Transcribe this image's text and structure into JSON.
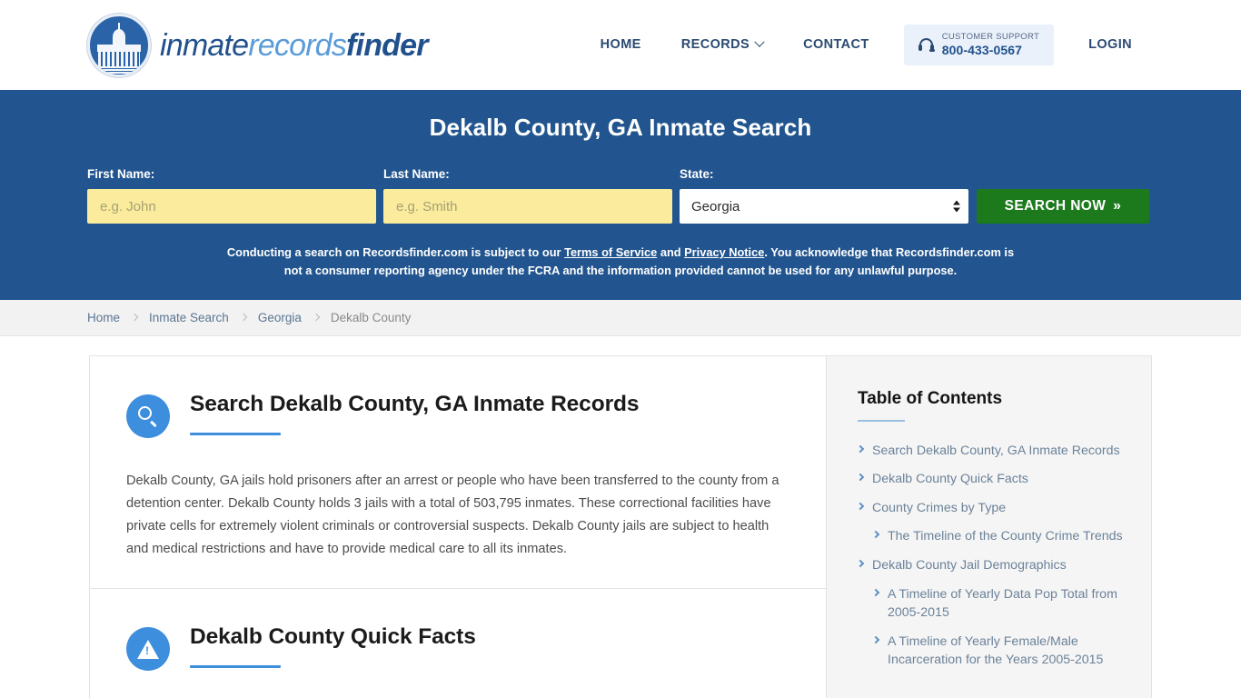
{
  "header": {
    "logo": {
      "part1": "inmate",
      "part2": "records",
      "part3": "finder",
      "icon": "capitol-seal-icon"
    },
    "nav": [
      {
        "label": "HOME",
        "has_caret": false
      },
      {
        "label": "RECORDS",
        "has_caret": true
      },
      {
        "label": "CONTACT",
        "has_caret": false
      }
    ],
    "support": {
      "label": "CUSTOMER SUPPORT",
      "phone": "800-433-0567",
      "icon": "headset-icon"
    },
    "login": "LOGIN"
  },
  "hero": {
    "title": "Dekalb County, GA Inmate Search",
    "fields": {
      "first_name_label": "First Name:",
      "first_name_placeholder": "e.g. John",
      "first_name_value": "",
      "last_name_label": "Last Name:",
      "last_name_placeholder": "e.g. Smith",
      "last_name_value": "",
      "state_label": "State:",
      "state_value": "Georgia"
    },
    "search_button": "SEARCH NOW",
    "search_button_chevrons": "»",
    "disclaimer": {
      "part1": "Conducting a search on Recordsfinder.com is subject to our ",
      "link1": "Terms of Service",
      "part2": " and ",
      "link2": "Privacy Notice",
      "part3": ". You acknowledge that Recordsfinder.com is not a consumer reporting agency under the FCRA and the information provided cannot be used for any unlawful purpose."
    }
  },
  "breadcrumb": [
    {
      "label": "Home",
      "current": false
    },
    {
      "label": "Inmate Search",
      "current": false
    },
    {
      "label": "Georgia",
      "current": false
    },
    {
      "label": "Dekalb County",
      "current": true
    }
  ],
  "main": {
    "sections": [
      {
        "icon": "search-circle-icon",
        "title": "Search Dekalb County, GA Inmate Records",
        "body": "Dekalb County, GA jails hold prisoners after an arrest or people who have been transferred to the county from a detention center. Dekalb County holds 3 jails with a total of 503,795 inmates. These correctional facilities have private cells for extremely violent criminals or controversial suspects. Dekalb County jails are subject to health and medical restrictions and have to provide medical care to all its inmates."
      },
      {
        "icon": "warning-circle-icon",
        "title": "Dekalb County Quick Facts",
        "body": ""
      }
    ]
  },
  "toc": {
    "title": "Table of Contents",
    "items": [
      {
        "label": "Search Dekalb County, GA Inmate Records",
        "level": 1
      },
      {
        "label": "Dekalb County Quick Facts",
        "level": 1
      },
      {
        "label": "County Crimes by Type",
        "level": 1
      },
      {
        "label": "The Timeline of the County Crime Trends",
        "level": 2
      },
      {
        "label": "Dekalb County Jail Demographics",
        "level": 1
      },
      {
        "label": "A Timeline of Yearly Data Pop Total from 2005-2015",
        "level": 2
      },
      {
        "label": "A Timeline of Yearly Female/Male Incarceration for the Years 2005-2015",
        "level": 2
      }
    ]
  },
  "colors": {
    "hero_blue": "#22558f",
    "brand_blue": "#20518c",
    "accent_blue": "#3e8ede",
    "button_green": "#1c7a1c",
    "input_yellow": "#faec9c"
  }
}
